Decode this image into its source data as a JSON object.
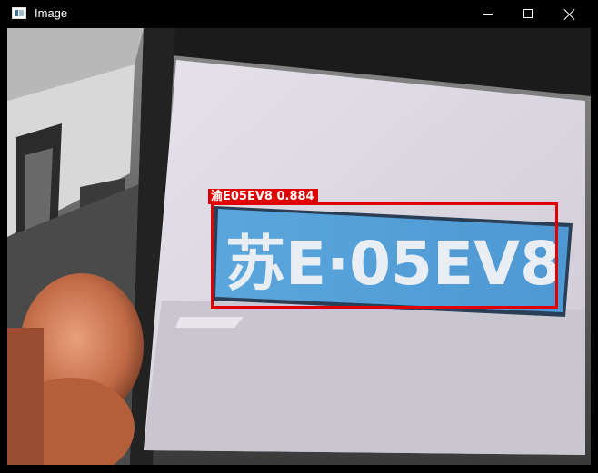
{
  "window": {
    "title": "Image",
    "icon": "image-window-icon",
    "controls": [
      "minimize-icon",
      "maximize-icon",
      "close-icon"
    ]
  },
  "detection": {
    "label": "渝E05EV8 0.884",
    "box_color": "#e00000",
    "plate_text": "苏E·05EV8"
  }
}
